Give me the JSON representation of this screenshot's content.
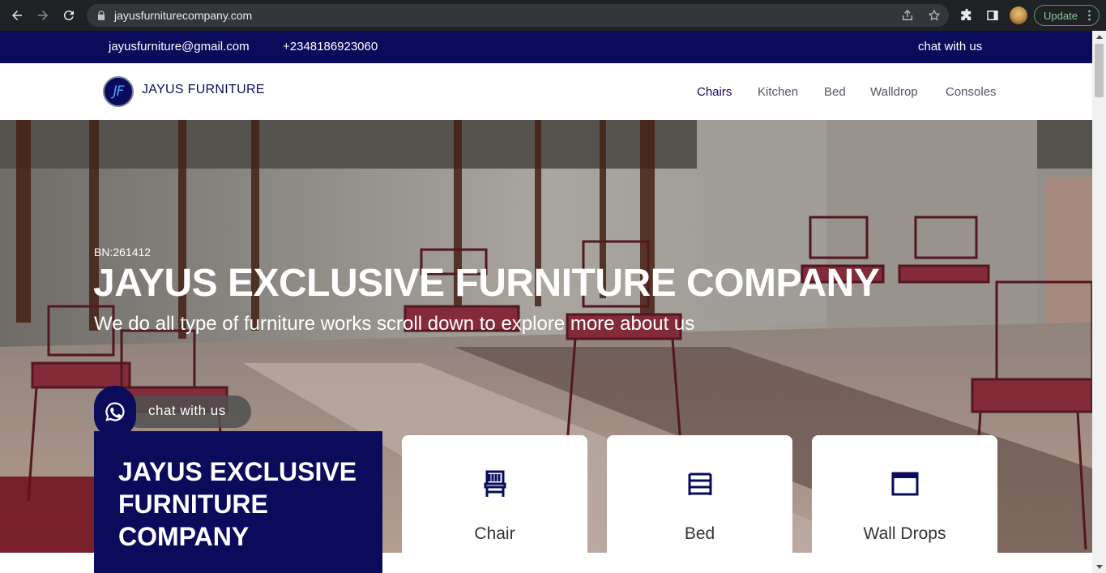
{
  "browser": {
    "url": "jayusfurniturecompany.com",
    "update_label": "Update"
  },
  "topbar": {
    "email": "jayusfurniture@gmail.com",
    "phone": "+2348186923060",
    "chat": "chat with us"
  },
  "navbar": {
    "logo_text": "JF",
    "brand": "JAYUS FURNITURE",
    "menu": [
      "Chairs",
      "Kitchen",
      "Bed",
      "Walldrop",
      "Consoles"
    ]
  },
  "hero": {
    "bn": "BN:261412",
    "title": "JAYUS EXCLUSIVE FURNITURE COMPANY",
    "subtitle": "We do all type of furniture works scroll down to explore more about us",
    "chat_label": "chat with us"
  },
  "promo": {
    "title": "JAYUS EXCLUSIVE FURNITURE COMPANY"
  },
  "cards": [
    {
      "label": "Chair",
      "icon": "chair-icon"
    },
    {
      "label": "Bed",
      "icon": "bed-icon"
    },
    {
      "label": "Wall Drops",
      "icon": "window-icon"
    }
  ],
  "colors": {
    "brand": "#0b0b5c",
    "update_green": "#81c995",
    "chrome_bg": "#202124"
  }
}
